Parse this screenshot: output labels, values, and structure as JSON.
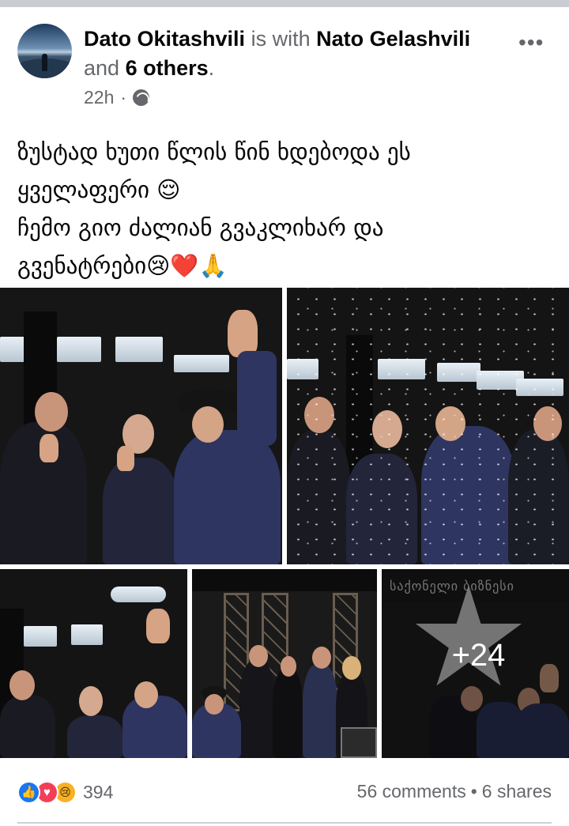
{
  "post": {
    "author": "Dato Okitashvili",
    "with_text": "is with",
    "tagged": "Nato Gelashvili",
    "and_text": "and",
    "others": "6 others",
    "period": ".",
    "time": "22h",
    "time_separator": "·",
    "privacy_icon": "globe-icon",
    "more_label": "•••",
    "text_lines": [
      "ზუსტად ხუთი წლის წინ ხდებოდა ეს",
      "ყველაფერი 😌",
      "ჩემო გიო ძალიან გვაკლიხარ და",
      "გვენატრები😢❤️🙏"
    ]
  },
  "photos": {
    "sign_text": "საქონელი ბიზნესი",
    "more_count": "+24"
  },
  "footer": {
    "reactions": {
      "icons": [
        "like-icon",
        "love-icon",
        "sad-icon"
      ],
      "like_glyph": "👍",
      "love_glyph": "♥",
      "sad_glyph": "😢",
      "count": "394"
    },
    "comments": "56 comments",
    "separator": "•",
    "shares": "6 shares"
  }
}
